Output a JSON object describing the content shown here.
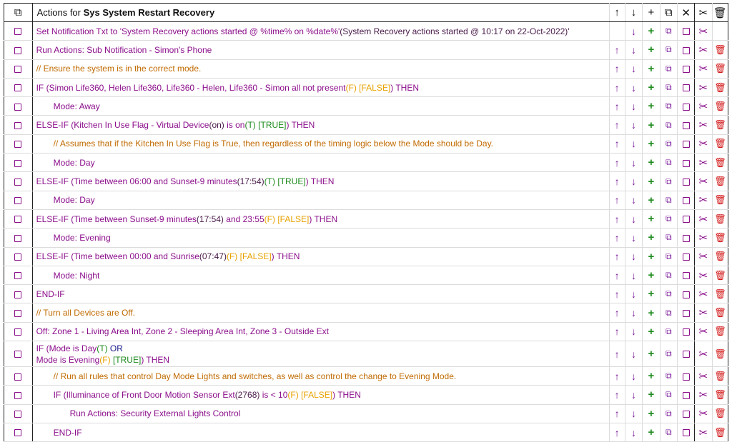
{
  "header": {
    "prefix": "Actions for",
    "rule_name": "Sys System Restart Recovery",
    "icons": [
      "move-up",
      "move-down",
      "insert",
      "copy",
      "close",
      "cut",
      "delete"
    ]
  },
  "rows": [
    {
      "indent": 0,
      "segments": [
        {
          "t": "Set Notification Txt to 'System Recovery actions started @ %time% on %date%'",
          "c": "p"
        },
        {
          "t": "(System Recovery actions started @ 10:17 on 22-Oct-2022)'",
          "c": "k"
        }
      ],
      "up": false,
      "del": false
    },
    {
      "indent": 0,
      "segments": [
        {
          "t": "Run Actions: Sub Notification - Simon's Phone",
          "c": "p"
        }
      ]
    },
    {
      "indent": 0,
      "segments": [
        {
          "t": "// Ensure the system is in the correct mode.",
          "c": "o"
        }
      ]
    },
    {
      "indent": 0,
      "segments": [
        {
          "t": "IF (Simon Life360, Helen Life360, Life360 - Helen, Life360 - Simon all not present",
          "c": "p"
        },
        {
          "t": "(F)",
          "c": "y"
        },
        {
          "t": " ",
          "c": "p"
        },
        {
          "t": "[FALSE]",
          "c": "y"
        },
        {
          "t": ") THEN",
          "c": "p"
        }
      ]
    },
    {
      "indent": 1,
      "segments": [
        {
          "t": "Mode: Away",
          "c": "p"
        }
      ]
    },
    {
      "indent": 0,
      "segments": [
        {
          "t": "ELSE-IF (Kitchen In Use Flag - Virtual Device",
          "c": "p"
        },
        {
          "t": "(on)",
          "c": "k"
        },
        {
          "t": " is on",
          "c": "p"
        },
        {
          "t": "(T)",
          "c": "g"
        },
        {
          "t": " ",
          "c": "p"
        },
        {
          "t": "[TRUE]",
          "c": "g"
        },
        {
          "t": ") THEN",
          "c": "p"
        }
      ]
    },
    {
      "indent": 1,
      "segments": [
        {
          "t": "// Assumes that if the Kitchen In Use Flag is True, then regardless of the timing logic below the Mode should be Day.",
          "c": "o"
        }
      ]
    },
    {
      "indent": 1,
      "segments": [
        {
          "t": "Mode: Day",
          "c": "p"
        }
      ]
    },
    {
      "indent": 0,
      "segments": [
        {
          "t": "ELSE-IF (Time between 06:00 and Sunset-9 minutes",
          "c": "p"
        },
        {
          "t": "(17:54)",
          "c": "k"
        },
        {
          "t": "(T)",
          "c": "g"
        },
        {
          "t": " ",
          "c": "p"
        },
        {
          "t": "[TRUE]",
          "c": "g"
        },
        {
          "t": ") THEN",
          "c": "p"
        }
      ]
    },
    {
      "indent": 1,
      "segments": [
        {
          "t": "Mode: Day",
          "c": "p"
        }
      ]
    },
    {
      "indent": 0,
      "segments": [
        {
          "t": "ELSE-IF (Time between Sunset-9 minutes",
          "c": "p"
        },
        {
          "t": "(17:54)",
          "c": "k"
        },
        {
          "t": " and 23:55",
          "c": "p"
        },
        {
          "t": "(F)",
          "c": "y"
        },
        {
          "t": " ",
          "c": "p"
        },
        {
          "t": "[FALSE]",
          "c": "y"
        },
        {
          "t": ") THEN",
          "c": "p"
        }
      ]
    },
    {
      "indent": 1,
      "segments": [
        {
          "t": "Mode: Evening",
          "c": "p"
        }
      ]
    },
    {
      "indent": 0,
      "segments": [
        {
          "t": "ELSE-IF (Time between 00:00 and Sunrise",
          "c": "p"
        },
        {
          "t": "(07:47)",
          "c": "k"
        },
        {
          "t": "(F)",
          "c": "y"
        },
        {
          "t": " ",
          "c": "p"
        },
        {
          "t": "[FALSE]",
          "c": "y"
        },
        {
          "t": ") THEN",
          "c": "p"
        }
      ]
    },
    {
      "indent": 1,
      "segments": [
        {
          "t": "Mode: Night",
          "c": "p"
        }
      ]
    },
    {
      "indent": 0,
      "segments": [
        {
          "t": "END-IF",
          "c": "p"
        }
      ]
    },
    {
      "indent": 0,
      "segments": [
        {
          "t": "// Turn all Devices are Off.",
          "c": "o"
        }
      ]
    },
    {
      "indent": 0,
      "segments": [
        {
          "t": "Off: Zone 1 - Living Area Int, Zone 2 - Sleeping Area Int, Zone 3 - Outside Ext",
          "c": "p"
        }
      ]
    },
    {
      "indent": 0,
      "tall": true,
      "segments": [
        {
          "t": "IF (Mode is Day",
          "c": "p"
        },
        {
          "t": "(T)",
          "c": "g"
        },
        {
          "t": "  OR",
          "c": "d"
        },
        {
          "t": "\n",
          "c": "br"
        },
        {
          "t": "Mode is Evening",
          "c": "p"
        },
        {
          "t": "(F)",
          "c": "y"
        },
        {
          "t": " ",
          "c": "p"
        },
        {
          "t": "[TRUE]",
          "c": "g"
        },
        {
          "t": ") THEN",
          "c": "p"
        }
      ]
    },
    {
      "indent": 1,
      "segments": [
        {
          "t": "// Run all rules that control Day Mode Lights and switches, as well as control the change to Evening Mode.",
          "c": "o"
        }
      ]
    },
    {
      "indent": 1,
      "segments": [
        {
          "t": "IF (Illuminance of Front Door Motion Sensor Ext",
          "c": "p"
        },
        {
          "t": "(2768)",
          "c": "k"
        },
        {
          "t": " is < 10",
          "c": "p"
        },
        {
          "t": "(F)",
          "c": "y"
        },
        {
          "t": " ",
          "c": "p"
        },
        {
          "t": "[FALSE]",
          "c": "y"
        },
        {
          "t": ") THEN",
          "c": "p"
        }
      ]
    },
    {
      "indent": 2,
      "segments": [
        {
          "t": "Run Actions: Security External Lights Control",
          "c": "p"
        }
      ]
    },
    {
      "indent": 1,
      "segments": [
        {
          "t": "END-IF",
          "c": "p"
        }
      ]
    }
  ],
  "glyphs": {
    "select_all": "⧉",
    "up": "↑",
    "down": "↓",
    "plus": "+",
    "copy": "⧉",
    "close": "✕",
    "cut": "✂",
    "trash": "🗑"
  },
  "colors": {
    "purple": "#8b0e8b",
    "orange": "#c06a00",
    "yellow": "#e8a200",
    "green": "#1c8a1c",
    "red": "#d21515"
  }
}
